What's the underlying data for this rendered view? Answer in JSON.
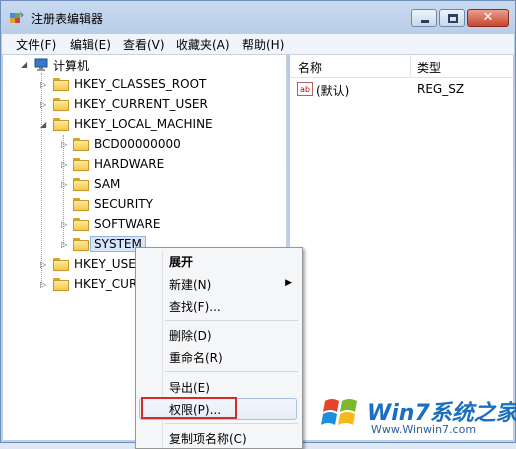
{
  "window": {
    "title": "注册表编辑器",
    "close_glyph": "✕"
  },
  "menubar": {
    "items": [
      "文件(F)",
      "编辑(E)",
      "查看(V)",
      "收藏夹(A)",
      "帮助(H)"
    ]
  },
  "tree": {
    "root": "计算机",
    "top_keys": [
      "HKEY_CLASSES_ROOT",
      "HKEY_CURRENT_USER",
      "HKEY_LOCAL_MACHINE"
    ],
    "hklm_children": [
      "BCD00000000",
      "HARDWARE",
      "SAM",
      "SECURITY",
      "SOFTWARE",
      "SYSTEM"
    ],
    "bottom_keys": [
      "HKEY_USE",
      "HKEY_CUR"
    ]
  },
  "list": {
    "col_name": "名称",
    "col_type": "类型",
    "row_icon_text": "ab",
    "row_name": "(默认)",
    "row_type": "REG_SZ"
  },
  "context_menu": {
    "items": [
      "展开",
      "新建(N)",
      "查找(F)...",
      "删除(D)",
      "重命名(R)",
      "导出(E)",
      "权限(P)...",
      "复制项名称(C)"
    ],
    "submenu_arrow": "▶"
  },
  "watermark": {
    "title": "Win7系统之家",
    "url": "Www.Winwin7.com"
  }
}
